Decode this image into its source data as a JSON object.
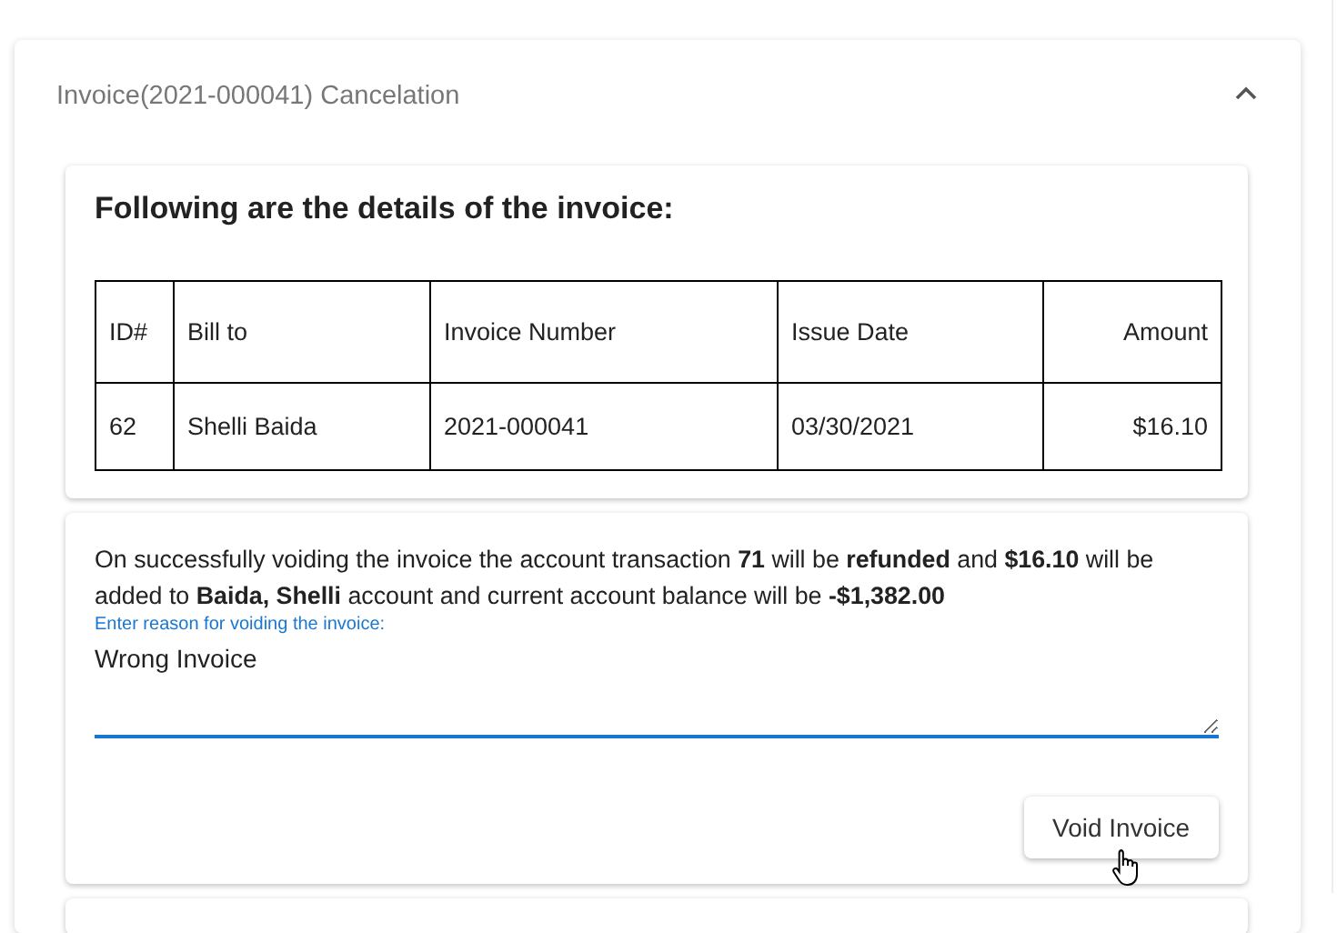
{
  "panel": {
    "title": "Invoice(2021-000041) Cancelation",
    "expanded": true
  },
  "details": {
    "heading": "Following are the details of the invoice:",
    "columns": [
      "ID#",
      "Bill to",
      "Invoice Number",
      "Issue Date",
      "Amount"
    ],
    "rows": [
      [
        "62",
        "Shelli Baida",
        "2021-000041",
        "03/30/2021",
        "$16.10"
      ]
    ]
  },
  "void": {
    "message": "On successfully voiding the invoice the account transaction **71** will be **refunded** and **$16.10** will be added to **Baida, Shelli** account and current account balance will be **-$1,382.00**",
    "reason": {
      "label": "Enter reason for voiding the invoice:",
      "value": "Wrong Invoice",
      "focused": true
    },
    "button": "Void Invoice"
  }
}
